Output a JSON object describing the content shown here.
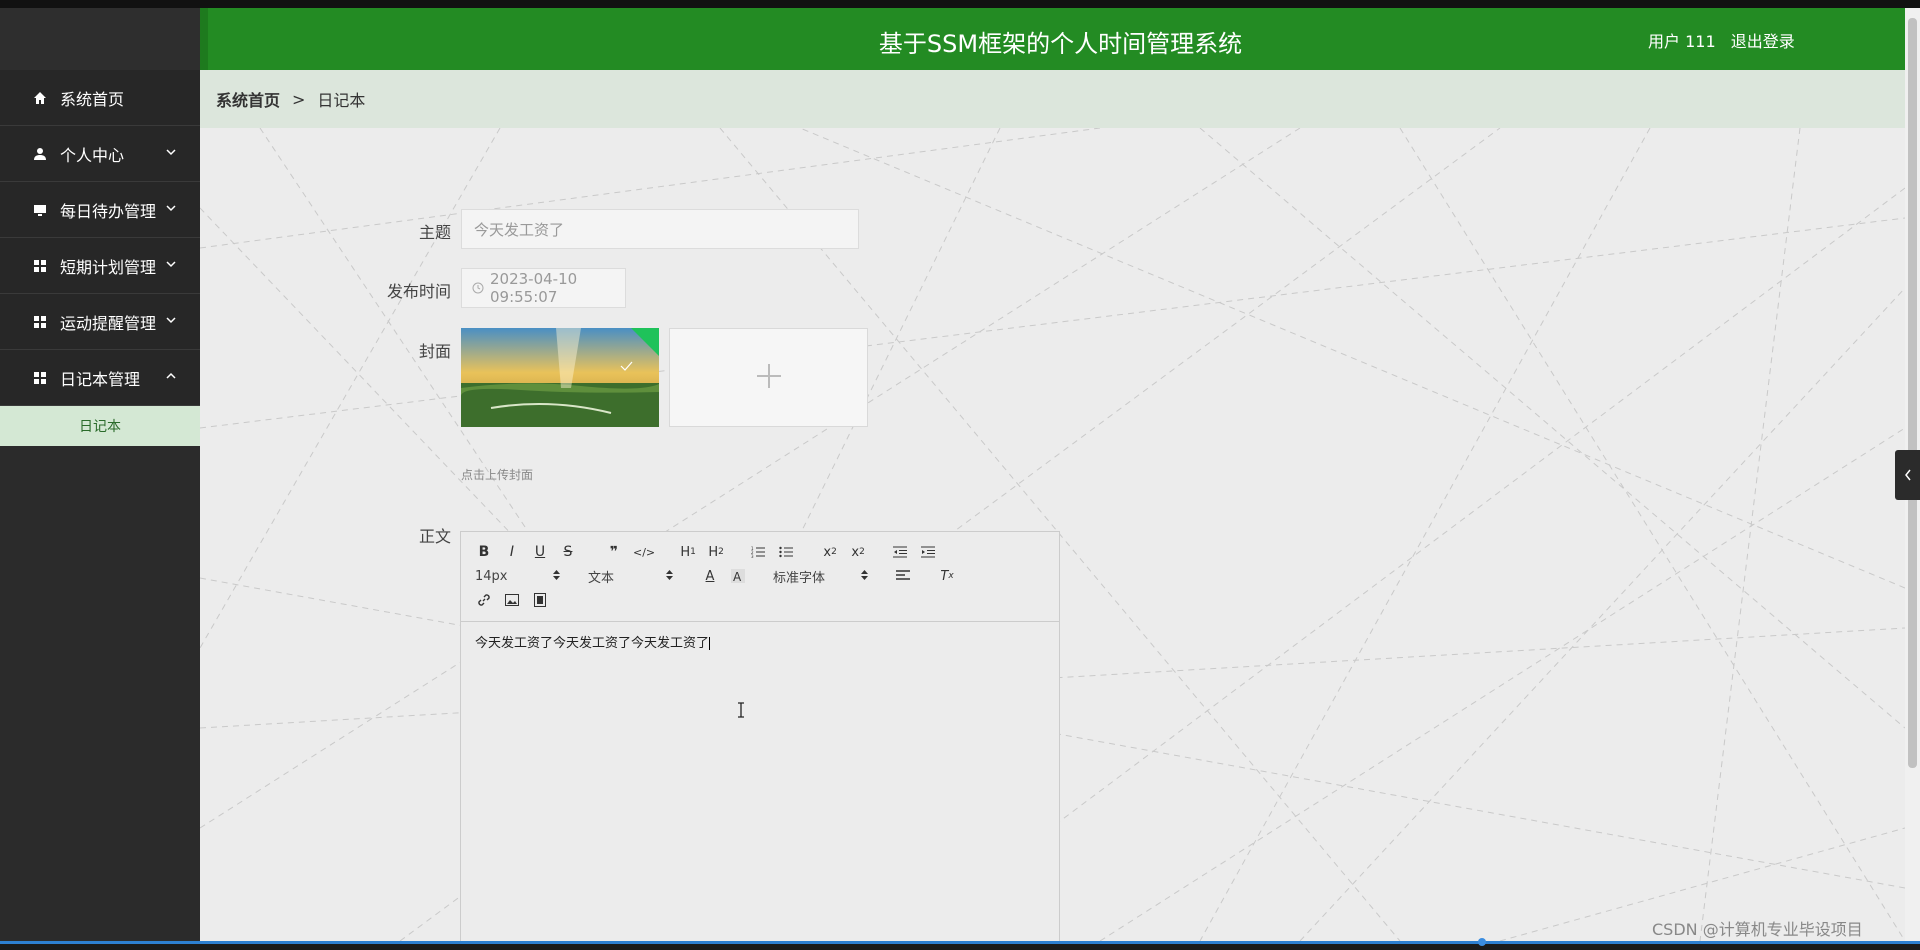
{
  "app": {
    "title": "基于SSM框架的个人时间管理系统",
    "user_text": "用户 111",
    "logout_label": "退出登录"
  },
  "sidebar": {
    "items": [
      {
        "label": "系统首页",
        "icon": "home-icon",
        "has_chevron": false
      },
      {
        "label": "个人中心",
        "icon": "user-icon",
        "has_chevron": true
      },
      {
        "label": "每日待办管理",
        "icon": "monitor-icon",
        "has_chevron": true
      },
      {
        "label": "短期计划管理",
        "icon": "grid-icon",
        "has_chevron": true
      },
      {
        "label": "运动提醒管理",
        "icon": "grid-icon",
        "has_chevron": true
      },
      {
        "label": "日记本管理",
        "icon": "grid-icon",
        "has_chevron": true,
        "expanded": true
      }
    ],
    "submenu": {
      "label": "日记本"
    }
  },
  "breadcrumb": {
    "home": "系统首页",
    "separator": ">",
    "current": "日记本"
  },
  "form": {
    "subject_label": "主题",
    "subject_value": "今天发工资了",
    "publish_time_label": "发布时间",
    "publish_time_value": "2023-04-10 09:55:07",
    "cover_label": "封面",
    "cover_hint": "点击上传封面",
    "body_label": "正文"
  },
  "editor": {
    "toolbar_row1": [
      "B",
      "I",
      "U",
      "S",
      "quote",
      "code",
      "H1",
      "H2",
      "ol",
      "ul",
      "sub",
      "sup",
      "outdent",
      "indent"
    ],
    "font_size": "14px",
    "block_type": "文本",
    "font_family": "标准字体",
    "content": "今天发工资了今天发工资了今天发工资了"
  },
  "watermark": "CSDN @计算机专业毕设项目",
  "colors": {
    "header": "#238b23",
    "sidebar": "#2b2b2b",
    "breadcrumb_bg": "#dce6dc",
    "submenu_bg": "#d4e8d4"
  }
}
